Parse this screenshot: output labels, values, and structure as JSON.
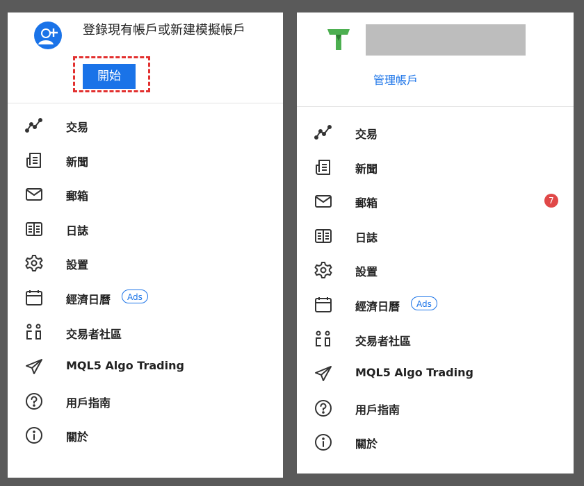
{
  "left_panel": {
    "login_text": "登錄現有帳戶或新建模擬帳戶",
    "start_button": "開始"
  },
  "right_panel": {
    "manage_link": "管理帳戶"
  },
  "menu": [
    {
      "label": "交易",
      "icon": "trade-chart-icon"
    },
    {
      "label": "新聞",
      "icon": "news-icon"
    },
    {
      "label": "郵箱",
      "icon": "mail-icon"
    },
    {
      "label": "日誌",
      "icon": "journal-icon"
    },
    {
      "label": "設置",
      "icon": "gear-icon"
    },
    {
      "label": "經濟日曆",
      "icon": "calendar-icon",
      "badge": "Ads"
    },
    {
      "label": "交易者社區",
      "icon": "community-icon"
    },
    {
      "label": "MQL5 Algo Trading",
      "icon": "send-icon"
    },
    {
      "label": "用戶指南",
      "icon": "help-icon"
    },
    {
      "label": "關於",
      "icon": "info-icon"
    }
  ],
  "mail_unread_count": "7",
  "colors": {
    "accent": "#1a73e8",
    "highlight_border": "#e2302f",
    "badge_red": "#e04848",
    "logo_green": "#4caf50",
    "background": "#5a5a5a"
  }
}
